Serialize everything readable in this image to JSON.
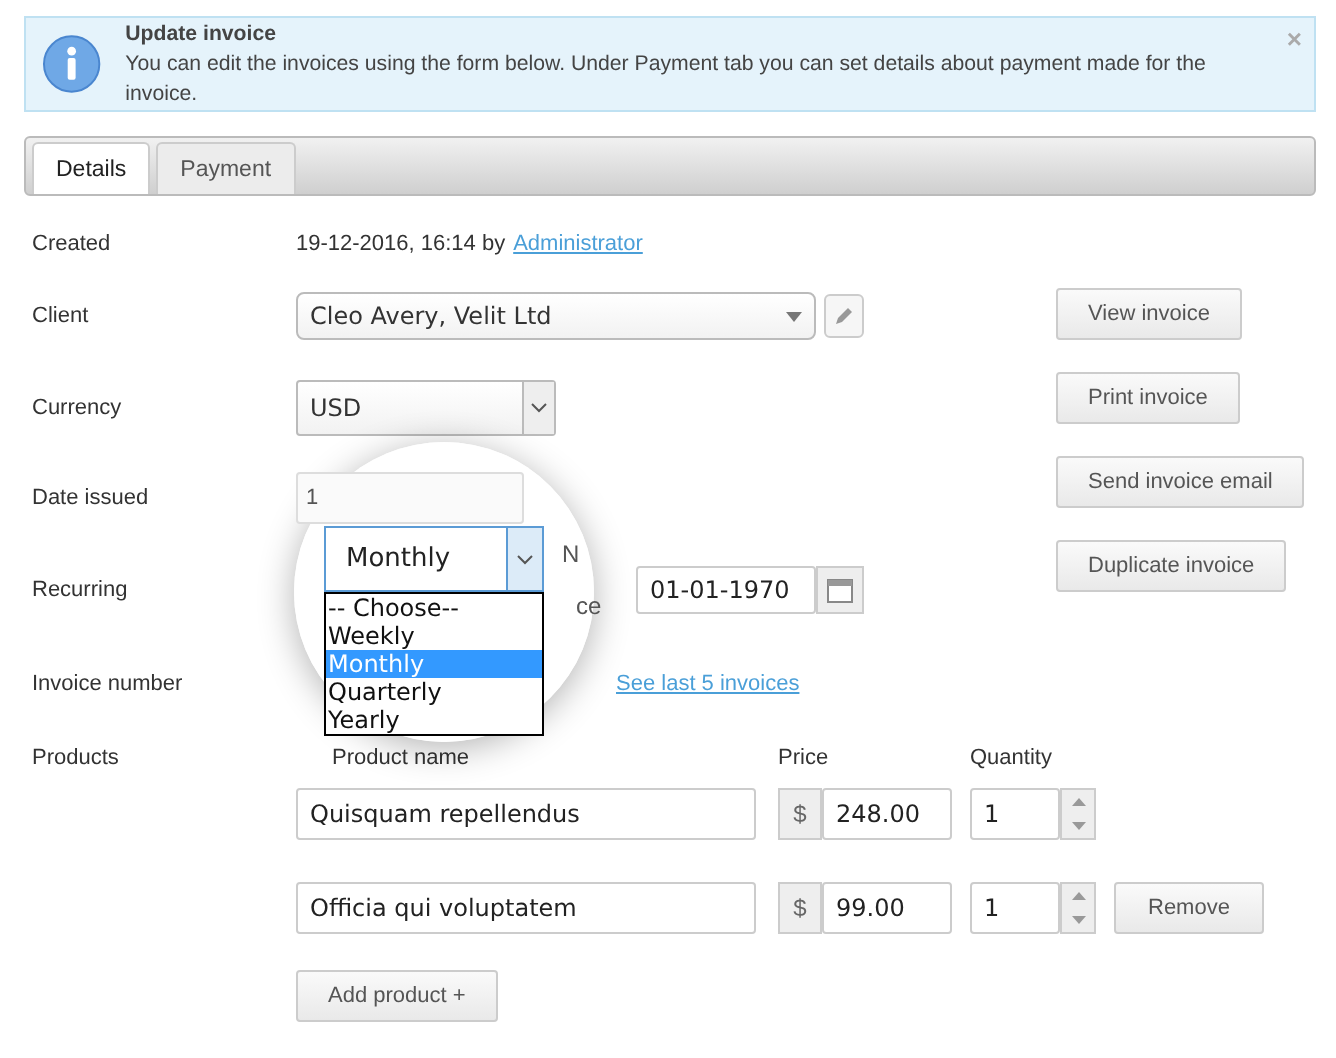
{
  "alert": {
    "title": "Update invoice",
    "message": "You can edit the invoices using the form below. Under Payment tab you can set details about payment made for the invoice.",
    "close": "×"
  },
  "tabs": [
    {
      "label": "Details",
      "selected": true
    },
    {
      "label": "Payment",
      "selected": false
    }
  ],
  "form": {
    "created": {
      "label": "Created",
      "value": "19-12-2016, 16:14 by",
      "link": "Administrator"
    },
    "client": {
      "label": "Client",
      "value": "Cleo Avery, Velit Ltd"
    },
    "currency": {
      "label": "Currency",
      "value": "USD"
    },
    "date_issued": {
      "label": "Date issued",
      "value": "1"
    },
    "recurring": {
      "label": "Recurring",
      "start_label": "ce",
      "start_date": "01-01-1970"
    },
    "invoice_number": {
      "label": "Invoice number",
      "link": "See last 5 invoices"
    },
    "products": {
      "label": "Products",
      "columns": [
        "Product name",
        "Price",
        "Quantity"
      ],
      "currency_symbol": "$",
      "rows": [
        {
          "name": "Quisquam repellendus",
          "price": "248.00",
          "quantity": "1"
        },
        {
          "name": "Officia qui voluptatem",
          "price": "99.00",
          "quantity": "1",
          "remove_label": "Remove"
        }
      ],
      "add_label": "Add product +"
    }
  },
  "actions": [
    "View invoice",
    "Print invoice",
    "Send invoice email",
    "Duplicate invoice"
  ],
  "magnifier": {
    "select_value": "Monthly",
    "side_label": "N",
    "options": [
      {
        "label": "-- Choose--",
        "selected": false
      },
      {
        "label": "Weekly",
        "selected": false
      },
      {
        "label": "Monthly",
        "selected": true
      },
      {
        "label": "Quarterly",
        "selected": false
      },
      {
        "label": "Yearly",
        "selected": false
      }
    ]
  }
}
